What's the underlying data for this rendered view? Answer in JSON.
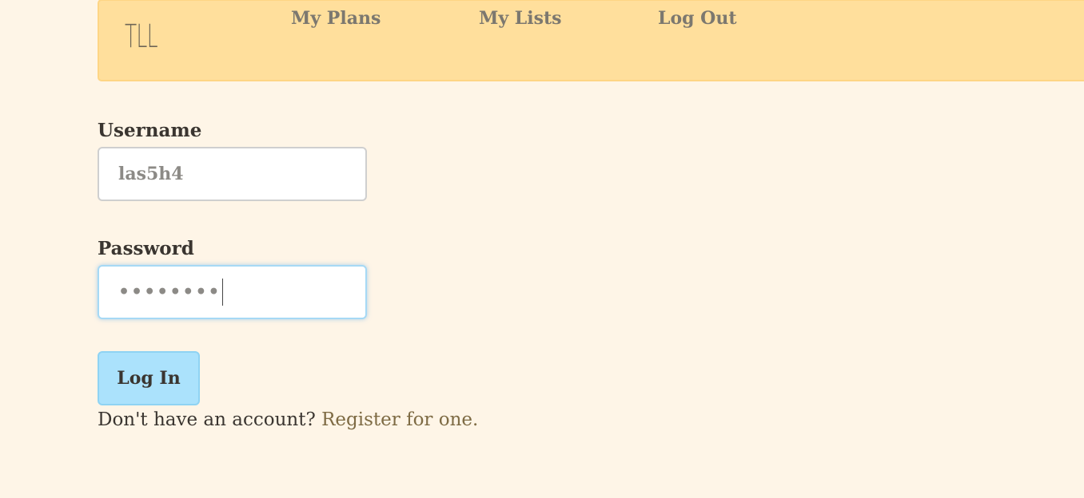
{
  "nav": {
    "brand": "TLL",
    "links": [
      "My Plans",
      "My Lists",
      "Log Out"
    ]
  },
  "form": {
    "username_label": "Username",
    "username_value": "las5h4",
    "password_label": "Password",
    "password_mask": "••••••••",
    "submit_label": "Log In"
  },
  "footer": {
    "prompt": "Don't have an account?",
    "register_label": "Register for one."
  },
  "colors": {
    "background": "#fef5e7",
    "navbar": "#ffdf9c",
    "button": "#abe2fc",
    "link": "#7e6b44"
  }
}
